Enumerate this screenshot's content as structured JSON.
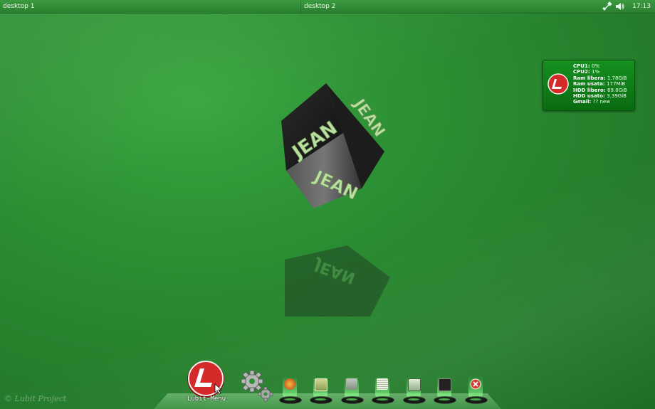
{
  "top_panel": {
    "desktops": [
      "desktop 1",
      "desktop 2"
    ],
    "tray": {
      "network_icon": "network-icon",
      "volume_icon": "volume-icon"
    },
    "clock": "17:13"
  },
  "cube": {
    "text": "JEAN"
  },
  "system_monitor": {
    "rows": [
      {
        "label": "CPU1:",
        "value": "0%"
      },
      {
        "label": "CPU2:",
        "value": "1%"
      },
      {
        "label": "Ram libera:",
        "value": "1.78GiB"
      },
      {
        "label": "Ram usata:",
        "value": "177MiB"
      },
      {
        "label": "HDD libero:",
        "value": "69.8GiB"
      },
      {
        "label": "HDD usato:",
        "value": "3.39GiB"
      },
      {
        "label": "Gmail:",
        "value": "?? new"
      }
    ],
    "logo_icon": "lubit-logo-icon"
  },
  "watermark": "©  Lubit Project",
  "dock": {
    "menu_label": "Lubit-Menu",
    "menu_icon": "lubit-logo-icon",
    "settings_icon": "gear-icon",
    "launchers": [
      {
        "icon": "browser-icon",
        "color": "#e0a040"
      },
      {
        "icon": "image-viewer-icon",
        "color": "#c8d080"
      },
      {
        "icon": "media-player-icon",
        "color": "#a0b0a0"
      },
      {
        "icon": "text-editor-icon",
        "color": "#d8e0c8"
      },
      {
        "icon": "file-manager-icon",
        "color": "#b8d0b0"
      },
      {
        "icon": "terminal-icon",
        "color": "#303030"
      },
      {
        "icon": "logout-icon",
        "color": "#d04030"
      }
    ]
  },
  "colors": {
    "background": "#2d9235",
    "accent": "#d42a2a"
  }
}
